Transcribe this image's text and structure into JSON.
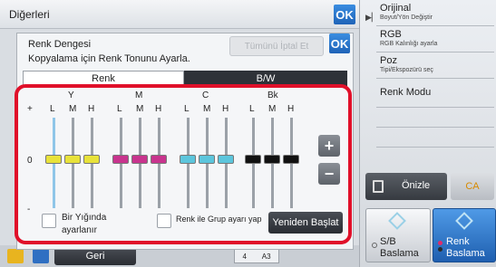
{
  "topbar": {
    "title": "Diğerleri",
    "ok": "OK"
  },
  "right_panel": {
    "items": [
      {
        "main": "Orijinal",
        "sub": "Boyut/Yön Değiştir"
      },
      {
        "main": "RGB",
        "sub": "RGB Kalınlığı ayarla"
      },
      {
        "main": "Poz",
        "sub": "Tipi/Ekspozürü seç"
      },
      {
        "main": "Renk Modu",
        "sub": ""
      }
    ],
    "preview": "Önizle",
    "ca": "CA",
    "bw_start_1": "S/B",
    "bw_start_2": "Baslama",
    "color_start_1": "Renk",
    "color_start_2": "Baslama"
  },
  "dialog": {
    "title": "Renk Dengesi",
    "subtitle": "Kopyalama için Renk Tonunu Ayarla.",
    "cancel_all": "Tümünü İptal Et",
    "ok": "OK",
    "tabs": [
      "Renk",
      "B/W"
    ],
    "colors": [
      {
        "name": "Y",
        "hex": "#e8e23a"
      },
      {
        "name": "M",
        "hex": "#c8348e"
      },
      {
        "name": "C",
        "hex": "#5cc5dc"
      },
      {
        "name": "Bk",
        "hex": "#111111"
      }
    ],
    "sub_labels": [
      "L",
      "M",
      "H"
    ],
    "scale_plus": "+",
    "scale_zero": "0",
    "scale_minus": "-",
    "plus_btn": "+",
    "minus_btn": "−",
    "checkbox1_1": "Bir Yığında",
    "checkbox1_2": "ayarlanır",
    "checkbox2": "Renk ile Grup ayarı yap",
    "reset": "Yeniden Başlat"
  },
  "bottom": {
    "back": "Geri",
    "page": "4",
    "size": "A3"
  }
}
